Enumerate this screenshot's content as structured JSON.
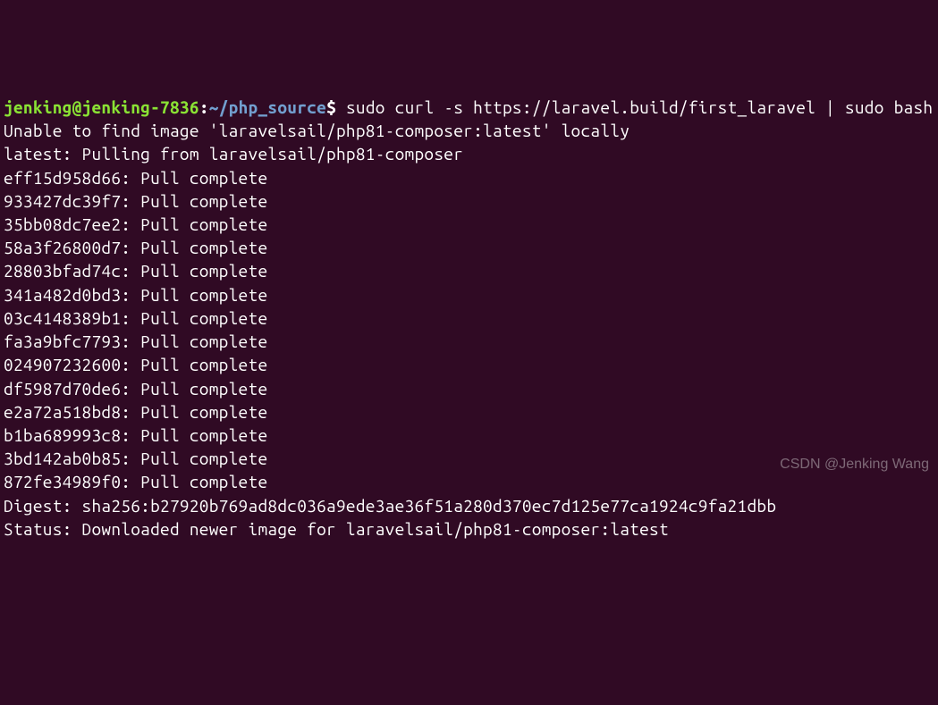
{
  "prompt": {
    "user": "jenking",
    "at": "@",
    "host": "jenking-7836",
    "colon": ":",
    "path": "~/php_source",
    "dollar": "$"
  },
  "command": " sudo curl -s https://laravel.build/first_laravel | sudo bash",
  "output": {
    "line1": "Unable to find image 'laravelsail/php81-composer:latest' locally",
    "line2": "latest: Pulling from laravelsail/php81-composer",
    "layers": [
      {
        "id": "eff15d958d66",
        "status": "Pull complete"
      },
      {
        "id": "933427dc39f7",
        "status": "Pull complete"
      },
      {
        "id": "35bb08dc7ee2",
        "status": "Pull complete"
      },
      {
        "id": "58a3f26800d7",
        "status": "Pull complete"
      },
      {
        "id": "28803bfad74c",
        "status": "Pull complete"
      },
      {
        "id": "341a482d0bd3",
        "status": "Pull complete"
      },
      {
        "id": "03c4148389b1",
        "status": "Pull complete"
      },
      {
        "id": "fa3a9bfc7793",
        "status": "Pull complete"
      },
      {
        "id": "024907232600",
        "status": "Pull complete"
      },
      {
        "id": "df5987d70de6",
        "status": "Pull complete"
      },
      {
        "id": "e2a72a518bd8",
        "status": "Pull complete"
      },
      {
        "id": "b1ba689993c8",
        "status": "Pull complete"
      },
      {
        "id": "3bd142ab0b85",
        "status": "Pull complete"
      },
      {
        "id": "872fe34989f0",
        "status": "Pull complete"
      }
    ],
    "digest": "Digest: sha256:b27920b769ad8dc036a9ede3ae36f51a280d370ec7d125e77ca1924c9fa21dbb",
    "status": "Status: Downloaded newer image for laravelsail/php81-composer:latest"
  },
  "watermark": "CSDN @Jenking Wang"
}
